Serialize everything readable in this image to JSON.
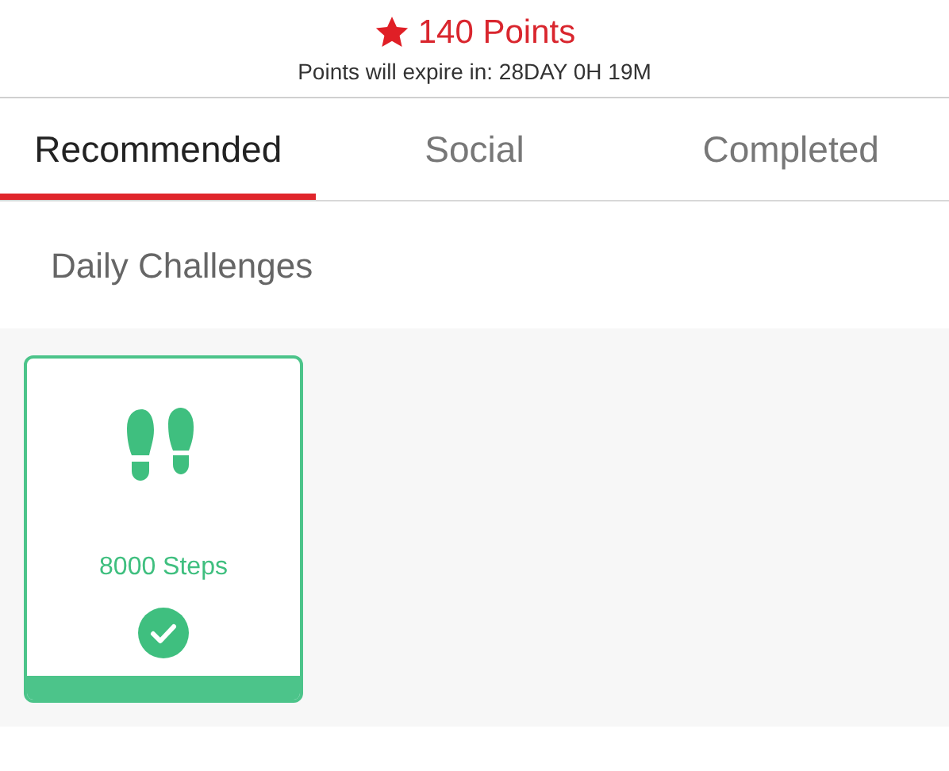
{
  "points": {
    "value": "140 Points",
    "expiry": "Points will expire in: 28DAY 0H 19M"
  },
  "tabs": [
    {
      "label": "Recommended",
      "selected": true
    },
    {
      "label": "Social",
      "selected": false
    },
    {
      "label": "Completed",
      "selected": false
    }
  ],
  "section_title": "Daily Challenges",
  "challenges": [
    {
      "label": "8000 Steps",
      "completed": true
    }
  ]
}
